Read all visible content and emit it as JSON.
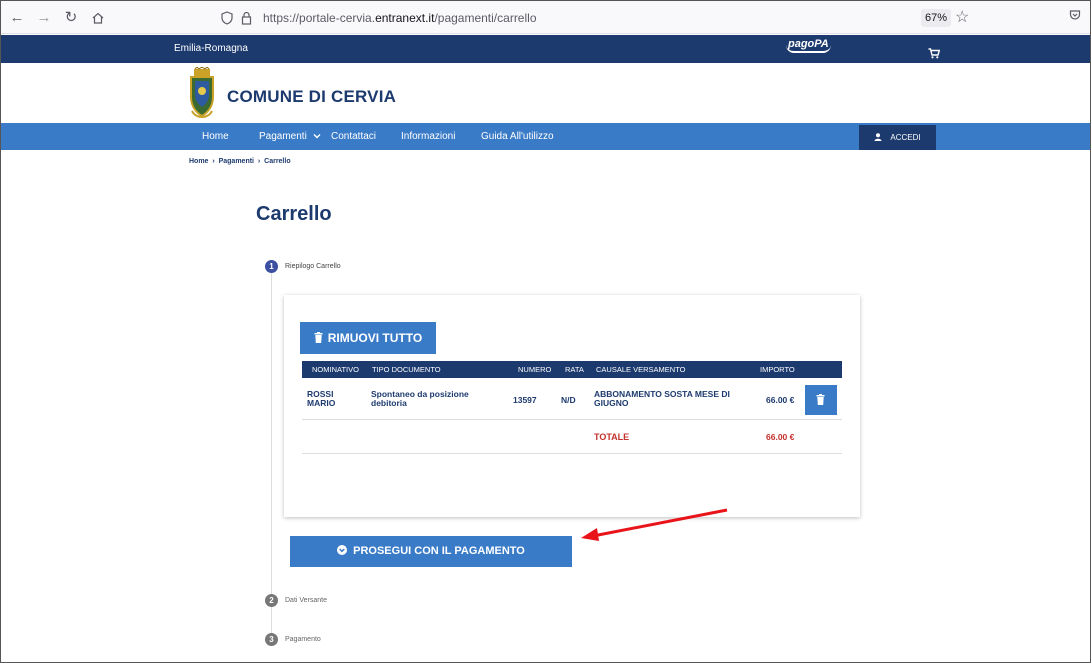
{
  "browser": {
    "url_prefix": "https://portale-cervia.",
    "url_domain": "entranext.it",
    "url_path": "/pagamenti/carrello",
    "zoom": "67%"
  },
  "header": {
    "region": "Emilia-Romagna",
    "pagopa_logo": "pagoPA",
    "city_name": "COMUNE DI CERVIA"
  },
  "menu": {
    "items": [
      "Home",
      "Pagamenti",
      "Contattaci",
      "Informazioni",
      "Guida All'utilizzo"
    ],
    "login_label": "ACCEDI"
  },
  "breadcrumb": [
    "Home",
    "Pagamenti",
    "Carrello"
  ],
  "page": {
    "title": "Carrello"
  },
  "steps": [
    {
      "number": "1",
      "label": "Riepilogo Carrello",
      "active": true
    },
    {
      "number": "2",
      "label": "Dati Versante",
      "active": false
    },
    {
      "number": "3",
      "label": "Pagamento",
      "active": false
    }
  ],
  "cart": {
    "remove_all_label": "RIMUOVI TUTTO",
    "columns": [
      "NOMINATIVO",
      "TIPO DOCUMENTO",
      "NUMERO",
      "RATA",
      "CAUSALE VERSAMENTO",
      "IMPORTO"
    ],
    "rows": [
      {
        "nominativo_1": "ROSSI",
        "nominativo_2": "MARIO",
        "tipo_1": "Spontaneo da posizione",
        "tipo_2": "debitoria",
        "numero": "13597",
        "rata": "N/D",
        "causale_1": "ABBONAMENTO SOSTA MESE DI",
        "causale_2": "GIUGNO",
        "importo": "66.00 €"
      }
    ],
    "total_label": "TOTALE",
    "total_value": "66.00 €",
    "proceed_label": "PROSEGUI CON IL PAGAMENTO"
  },
  "colors": {
    "navy": "#1d3a6e",
    "blue": "#3a7bc8",
    "red": "#c4302b",
    "annotation_arrow": "#e8141a"
  }
}
